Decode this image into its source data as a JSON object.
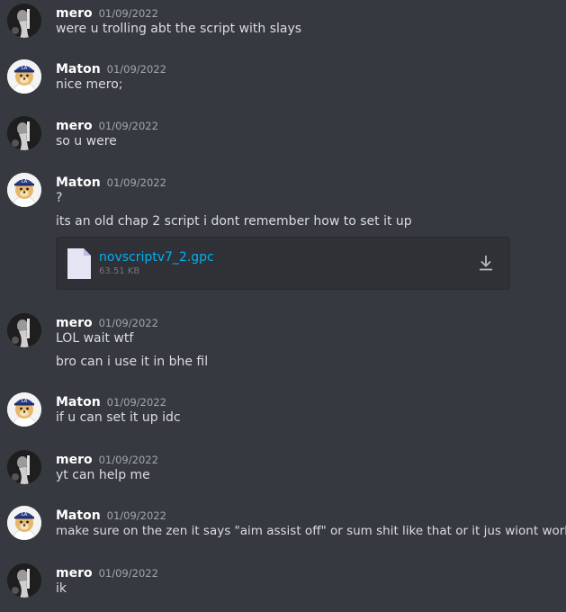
{
  "messages": [
    {
      "author": "mero",
      "timestamp": "01/09/2022",
      "lines": [
        "were u trolling abt the script with slays"
      ]
    },
    {
      "author": "Maton",
      "timestamp": "01/09/2022",
      "lines": [
        "nice mero;"
      ]
    },
    {
      "author": "mero",
      "timestamp": "01/09/2022",
      "lines": [
        "so u were"
      ]
    },
    {
      "author": "Maton",
      "timestamp": "01/09/2022",
      "lines": [
        "?",
        "its an old chap 2 script i dont remember how to set it up"
      ],
      "attachment": {
        "filename": "novscriptv7_2.gpc",
        "size": "63.51 KB",
        "icon": "file-icon",
        "action_icon": "download-icon"
      }
    },
    {
      "author": "mero",
      "timestamp": "01/09/2022",
      "lines": [
        "LOL wait wtf",
        "bro can i use it in bhe fil"
      ]
    },
    {
      "author": "Maton",
      "timestamp": "01/09/2022",
      "lines": [
        "if u can set it up idc"
      ]
    },
    {
      "author": "mero",
      "timestamp": "01/09/2022",
      "lines": [
        "yt can help me"
      ]
    },
    {
      "author": "Maton",
      "timestamp": "01/09/2022",
      "lines": [
        "make sure on the zen it says \"aim assist off\" or sum shit like that or it jus wiont work"
      ]
    },
    {
      "author": "mero",
      "timestamp": "01/09/2022",
      "lines": [
        "ik"
      ]
    }
  ],
  "colors": {
    "background": "#36393f",
    "author": "#ffffff",
    "timestamp": "#a3a6aa",
    "text": "#dcddde",
    "link": "#00b0f4",
    "attachment_bg": "#2f3136"
  }
}
